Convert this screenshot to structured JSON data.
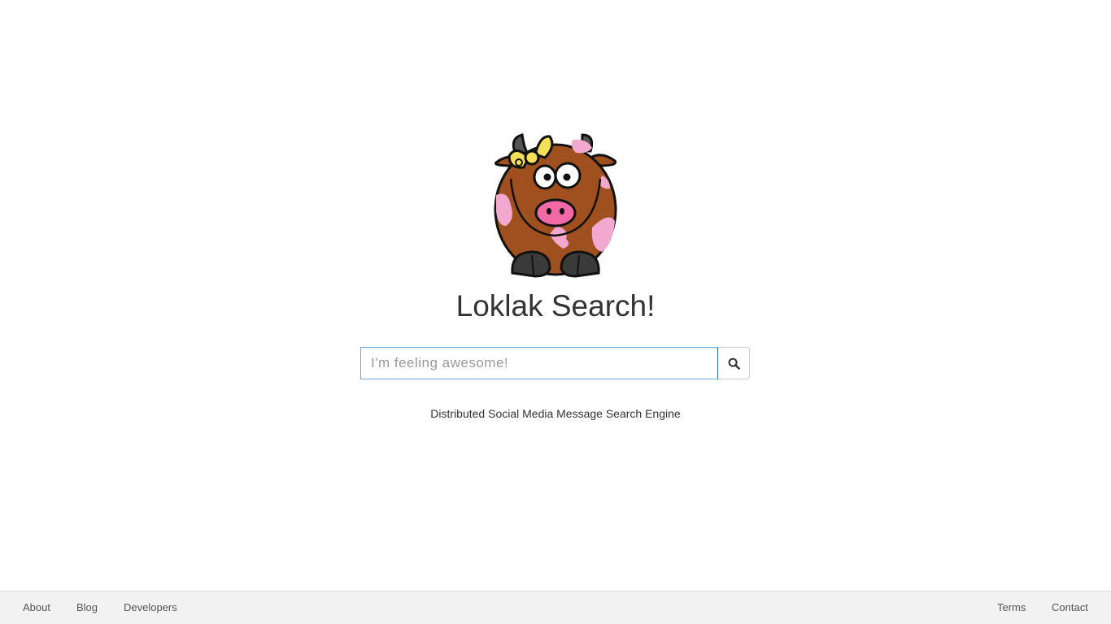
{
  "header": {
    "title": "Loklak Search!",
    "logo": "loklak-cow-logo"
  },
  "search": {
    "placeholder": "I'm feeling awesome!",
    "value": "",
    "button_icon": "search-icon"
  },
  "tagline": "Distributed Social Media Message Search Engine",
  "footer": {
    "left_links": [
      "About",
      "Blog",
      "Developers"
    ],
    "right_links": [
      "Terms",
      "Contact"
    ]
  },
  "colors": {
    "focus_border": "#66afe9",
    "footer_bg": "#f2f2f2",
    "cow_brown": "#a0501f",
    "cow_pink": "#f2a8cf",
    "bow_yellow": "#f6e05a"
  }
}
